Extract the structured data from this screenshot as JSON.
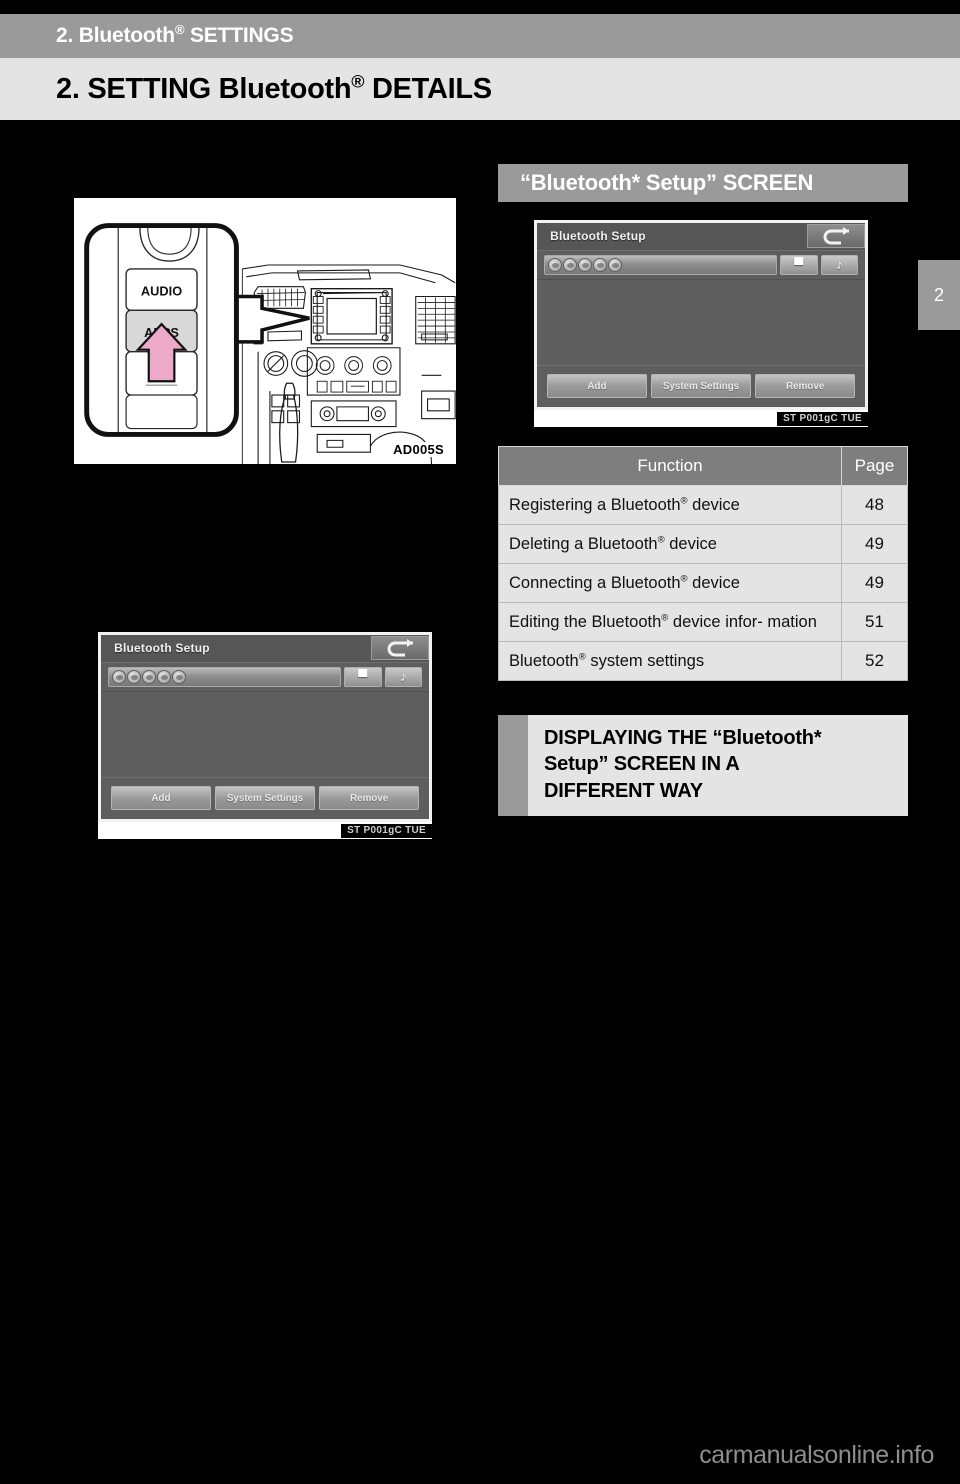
{
  "header": {
    "chapter_label_pre": "2. Bluetooth",
    "chapter_label_reg": "®",
    "chapter_label_post": " SETTINGS",
    "title_pre": "2. SETTING Bluetooth",
    "title_reg": "®",
    "title_post": " DETAILS",
    "chapter_tab_number": "2",
    "band_color": "#9a9a9a",
    "title_band_color": "#e4e4e4",
    "page_background": "#000000"
  },
  "illustration": {
    "code": "AD005S",
    "button_audio_label": "AUDIO",
    "button_apps_label": "APPS",
    "arrow_color": "#eda9c8",
    "highlight_button": "APPS"
  },
  "device_screen": {
    "title": "Bluetooth Setup",
    "status_icons": [
      "bluetooth-icon",
      "signal-icon",
      "battery-icon"
    ],
    "back_icon": "return-arrow-icon",
    "tab_circles": 5,
    "toolbar_buttons": [
      {
        "icon": "phone-icon",
        "glyph": "▀"
      },
      {
        "icon": "music-note-icon",
        "glyph": "♪"
      }
    ],
    "bottom_buttons": [
      "Add",
      "System Settings",
      "Remove"
    ],
    "caption": "ST P001gC TUE"
  },
  "right_section": {
    "heading": "“Bluetooth* Setup” SCREEN",
    "table": {
      "columns": [
        "Function",
        "Page"
      ],
      "rows": [
        {
          "fn_pre": "Registering a Bluetooth",
          "fn_reg": "®",
          "fn_post": " device",
          "page": "48"
        },
        {
          "fn_pre": "Deleting a Bluetooth",
          "fn_reg": "®",
          "fn_post": " device",
          "page": "49"
        },
        {
          "fn_pre": "Connecting a Bluetooth",
          "fn_reg": "®",
          "fn_post": " device",
          "page": "49"
        },
        {
          "fn_pre": "Editing the Bluetooth",
          "fn_reg": "®",
          "fn_post": " device infor-\nmation",
          "page": "51"
        },
        {
          "fn_pre": "Bluetooth",
          "fn_reg": "®",
          "fn_post": " system settings",
          "page": "52"
        }
      ]
    },
    "sub_heading_line1": "DISPLAYING THE “Bluetooth*",
    "sub_heading_line2": "Setup” SCREEN IN A",
    "sub_heading_line3": "DIFFERENT WAY"
  },
  "footer": {
    "watermark": "carmanualsonline.info"
  }
}
